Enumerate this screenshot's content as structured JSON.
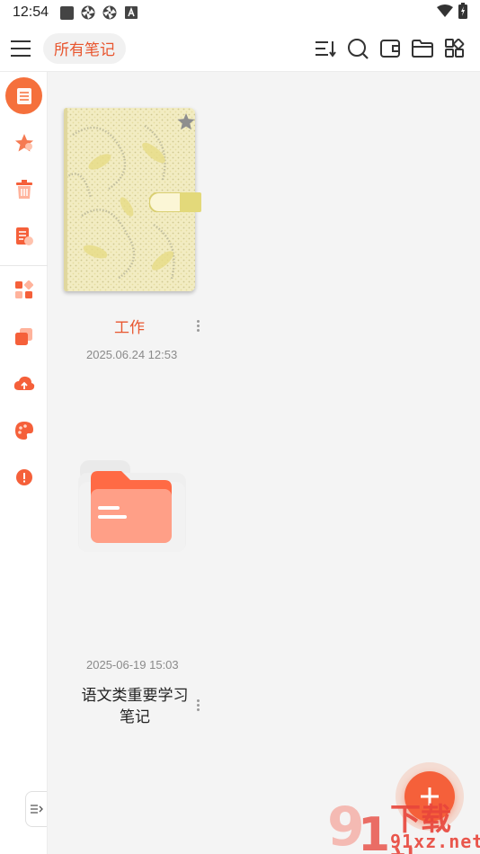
{
  "status_bar": {
    "time": "12:54",
    "left_icons": [
      "square-app-icon",
      "aperture-icon",
      "aperture-icon",
      "a-badge-icon"
    ],
    "right_icons": [
      "wifi-icon",
      "battery-charging-icon"
    ]
  },
  "app_bar": {
    "menu_icon": "hamburger-menu-icon",
    "title": "所有笔记",
    "actions": [
      "sort-icon",
      "search-icon",
      "wallet-icon",
      "folder-icon",
      "grid-apps-icon"
    ]
  },
  "sidebar": {
    "items": [
      {
        "icon": "notes-list-icon",
        "active": true
      },
      {
        "icon": "star-favorites-icon",
        "active": false
      },
      {
        "icon": "trash-icon",
        "active": false
      },
      {
        "icon": "document-icon",
        "active": false
      },
      {
        "icon": "widgets-icon",
        "active": false
      },
      {
        "icon": "layers-icon",
        "active": false
      },
      {
        "icon": "cloud-upload-icon",
        "active": false
      },
      {
        "icon": "palette-icon",
        "active": false
      },
      {
        "icon": "info-icon",
        "active": false
      }
    ],
    "collapse_icon": "expand-sidebar-icon"
  },
  "notes": [
    {
      "type": "notebook",
      "title": "工作",
      "date": "2025.06.24 12:53",
      "starred_icon": "star-icon"
    },
    {
      "type": "folder",
      "title": "语文类重要学习笔记",
      "date": "2025-06-19 15:03"
    }
  ],
  "fab": {
    "icon": "plus-icon"
  },
  "watermark": {
    "text": "下载站",
    "domain": "91xz.net",
    "logo": "91-logo"
  },
  "colors": {
    "accent": "#f5703c",
    "title_active": "#e8562f",
    "notebook": "#efe7b4",
    "notebook_clip": "#e3d97a",
    "folder_front": "#ff9f87",
    "folder_back": "#ff6a45"
  }
}
